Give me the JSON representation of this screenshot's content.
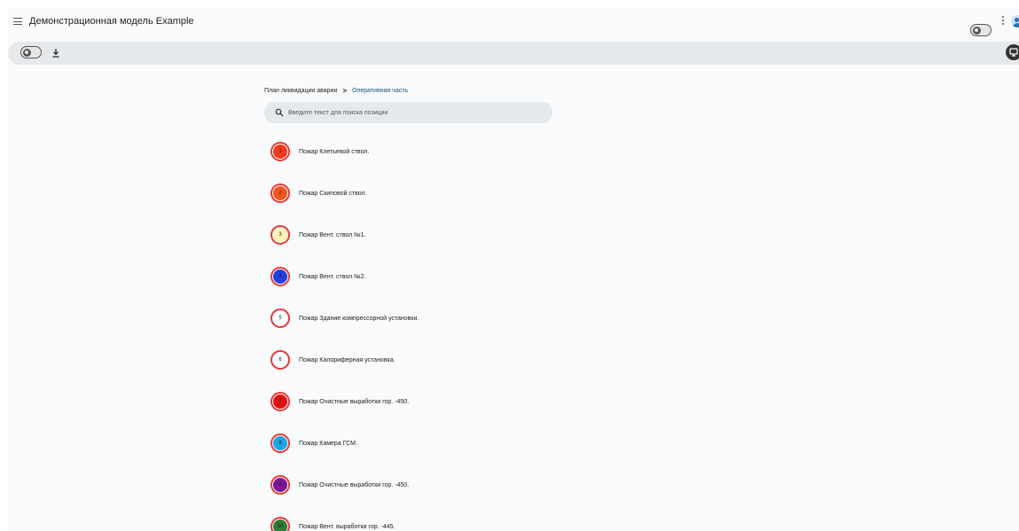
{
  "app": {
    "title": "Демонстрационная модель Example"
  },
  "breadcrumb": {
    "root": "План ликвидации аварии",
    "separator": ">",
    "current": "Оперативная часть"
  },
  "search": {
    "placeholder": "Введите текст для поиска позиции",
    "value": ""
  },
  "colors": {
    "marker_border": "#e53935",
    "breadcrumb_current": "#1d4f7a",
    "toolbar_bg": "#e6e9ec",
    "page_bg": "#f8fafc"
  },
  "items": [
    {
      "number": "1",
      "label": "Пожар Клетьевой ствол.",
      "color": "#f33a1a"
    },
    {
      "number": "2",
      "label": "Пожар Скиповой ствол.",
      "color": "#f4561c"
    },
    {
      "number": "3",
      "label": "Пожар Вент. ствол №1.",
      "color": "#fff4b8"
    },
    {
      "number": "4",
      "label": "Пожар Вент. ствол №2.",
      "color": "#1e40e6"
    },
    {
      "number": "5",
      "label": "Пожар Здание компрессорной установки.",
      "color": "#ffffff"
    },
    {
      "number": "6",
      "label": "Пожар Калориферная установка.",
      "color": "#ffffff"
    },
    {
      "number": "7",
      "label": "Пожар Очистные выработки гор. -450.",
      "color": "#e01010"
    },
    {
      "number": "8",
      "label": "Пожар Камера ГСМ.",
      "color": "#1ea5e8"
    },
    {
      "number": "9",
      "label": "Пожар Очистные выработки гор. -450.",
      "color": "#7b1596"
    },
    {
      "number": "10",
      "label": "Пожар Вент. выработки гор. -445.",
      "color": "#2e7d32"
    }
  ]
}
